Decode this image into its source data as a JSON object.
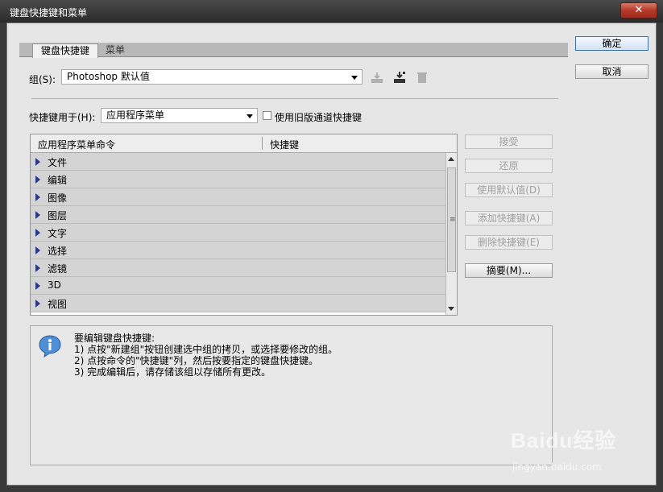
{
  "window": {
    "title": "键盘快捷键和菜单",
    "close_label": "✕"
  },
  "tabs": [
    {
      "label": "键盘快捷键"
    },
    {
      "label": "菜单"
    }
  ],
  "set": {
    "label": "组(S):",
    "value": "Photoshop 默认值"
  },
  "shortcuts_for": {
    "label": "快捷键用于(H):",
    "value": "应用程序菜单"
  },
  "legacy_checkbox": {
    "label": "使用旧版通道快捷键",
    "checked": false
  },
  "table": {
    "headers": [
      "应用程序菜单命令",
      "快捷键"
    ],
    "rows": [
      "文件",
      "编辑",
      "图像",
      "图层",
      "文字",
      "选择",
      "滤镜",
      "3D",
      "视图"
    ]
  },
  "side_buttons": {
    "accept": "接受",
    "undo": "还原",
    "use_default": "使用默认值(D)",
    "add_shortcut": "添加快捷键(A)",
    "delete_shortcut": "删除快捷键(E)",
    "summarize": "摘要(M)..."
  },
  "dialog_buttons": {
    "ok": "确定",
    "cancel": "取消"
  },
  "info": {
    "lines": [
      "要编辑键盘快捷键:",
      "1) 点按\"新建组\"按钮创建选中组的拷贝，或选择要修改的组。",
      "2) 点按命令的\"快捷键\"列，然后按要指定的键盘快捷键。",
      "3) 完成编辑后，请存储该组以存储所有更改。"
    ]
  },
  "watermark": {
    "brand": "Baidu经验",
    "url": "jingyan.baidu.com"
  },
  "icons": [
    "save-set-icon",
    "save-set-as-icon",
    "delete-set-icon",
    "info-icon"
  ]
}
